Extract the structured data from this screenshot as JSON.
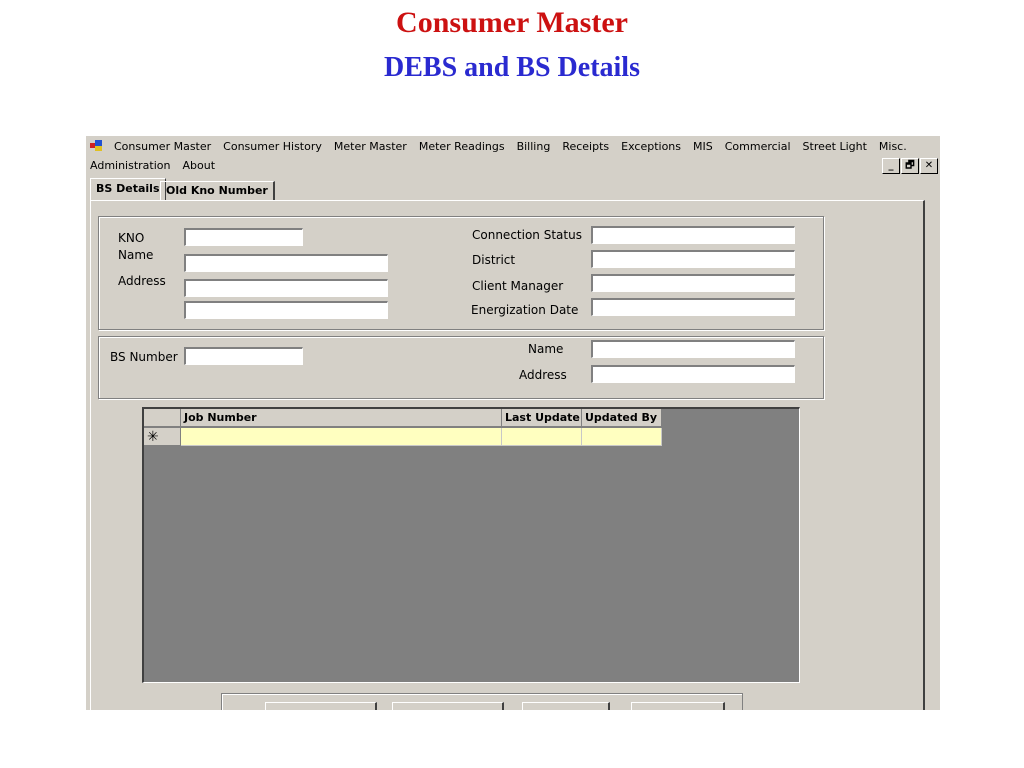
{
  "slide": {
    "title": "Consumer Master",
    "subtitle": "DEBS and BS Details"
  },
  "menu": {
    "row1": [
      "Consumer Master",
      "Consumer History",
      "Meter Master",
      "Meter Readings",
      "Billing",
      "Receipts",
      "Exceptions",
      "MIS",
      "Commercial",
      "Street Light",
      "Misc."
    ],
    "row2": [
      "Administration",
      "About"
    ]
  },
  "window_controls": {
    "minimize": "_",
    "restore": "🗗",
    "close": "✕"
  },
  "tabs": [
    "BS Details",
    "Old Kno Number"
  ],
  "consumer_group": {
    "kno_label": "KNO",
    "name_label": "Name",
    "address_label": "Address",
    "connection_status_label": "Connection Status",
    "district_label": "District",
    "client_manager_label": "Client Manager",
    "energization_date_label": "Energization Date",
    "kno_value": "",
    "name_value": "",
    "address_line1": "",
    "address_line2": "",
    "connection_status_value": "",
    "district_value": "",
    "client_manager_value": "",
    "energization_date_value": ""
  },
  "bs_group": {
    "bs_number_label": "BS Number",
    "name_label": "Name",
    "address_label": "Address",
    "bs_number_value": "",
    "name_value": "",
    "address_value": ""
  },
  "grid": {
    "columns": [
      "Job Number",
      "Last Update",
      "Updated By"
    ],
    "new_row_marker": "✳"
  },
  "colors": {
    "title_red": "#cc1111",
    "subtitle_blue": "#2a2ad0",
    "window_face": "#d4d0c8",
    "grid_background": "#808080",
    "new_row_fill": "#ffffc0"
  }
}
